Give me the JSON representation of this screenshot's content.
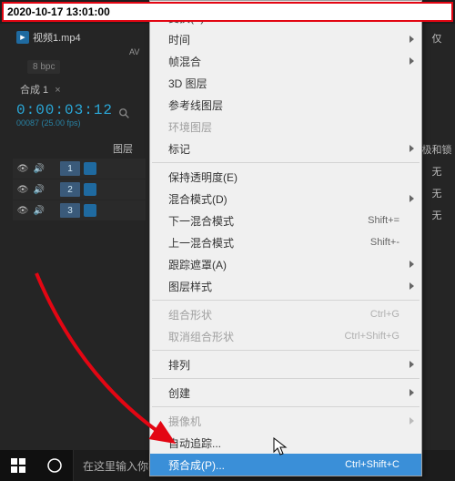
{
  "timestamp": "2020-10-17 13:01:00",
  "project": {
    "file_name": "视频1.mp4",
    "format": "AV"
  },
  "footer": {
    "bpc": "8 bpc"
  },
  "timeline": {
    "tab": "合成 1",
    "tab_close": "×",
    "timecode": "0:00:03:12",
    "timecode_sub": "00087 (25.00 fps)",
    "col_header": "图层",
    "tracks": [
      {
        "num": "1"
      },
      {
        "num": "2"
      },
      {
        "num": "3"
      }
    ]
  },
  "right": {
    "label1": "仅",
    "label2": "极和锁",
    "v1": "无",
    "v2": "无",
    "v3": "无"
  },
  "menu": {
    "items": [
      {
        "label": "变换(T)",
        "sub": true,
        "cut": true
      },
      {
        "label": "时间",
        "sub": true
      },
      {
        "label": "帧混合",
        "sub": true
      },
      {
        "label": "3D 图层"
      },
      {
        "label": "参考线图层"
      },
      {
        "label": "环境图层",
        "disabled": true
      },
      {
        "label": "标记",
        "sub": true
      },
      {
        "sep": true
      },
      {
        "label": "保持透明度(E)"
      },
      {
        "label": "混合模式(D)",
        "sub": true
      },
      {
        "label": "下一混合模式",
        "shortcut": "Shift+="
      },
      {
        "label": "上一混合模式",
        "shortcut": "Shift+-"
      },
      {
        "label": "跟踪遮罩(A)",
        "sub": true
      },
      {
        "label": "图层样式",
        "sub": true
      },
      {
        "sep": true
      },
      {
        "label": "组合形状",
        "shortcut": "Ctrl+G",
        "disabled": true
      },
      {
        "label": "取消组合形状",
        "shortcut": "Ctrl+Shift+G",
        "disabled": true
      },
      {
        "sep": true
      },
      {
        "label": "排列",
        "sub": true
      },
      {
        "sep": true
      },
      {
        "label": "创建",
        "sub": true
      },
      {
        "sep": true
      },
      {
        "label": "摄像机",
        "sub": true,
        "disabled": true
      },
      {
        "label": "自动追踪..."
      },
      {
        "label": "预合成(P)...",
        "shortcut": "Ctrl+Shift+C",
        "hover": true
      }
    ]
  },
  "taskbar": {
    "search_placeholder": "在这里输入你要搜索的内容"
  }
}
